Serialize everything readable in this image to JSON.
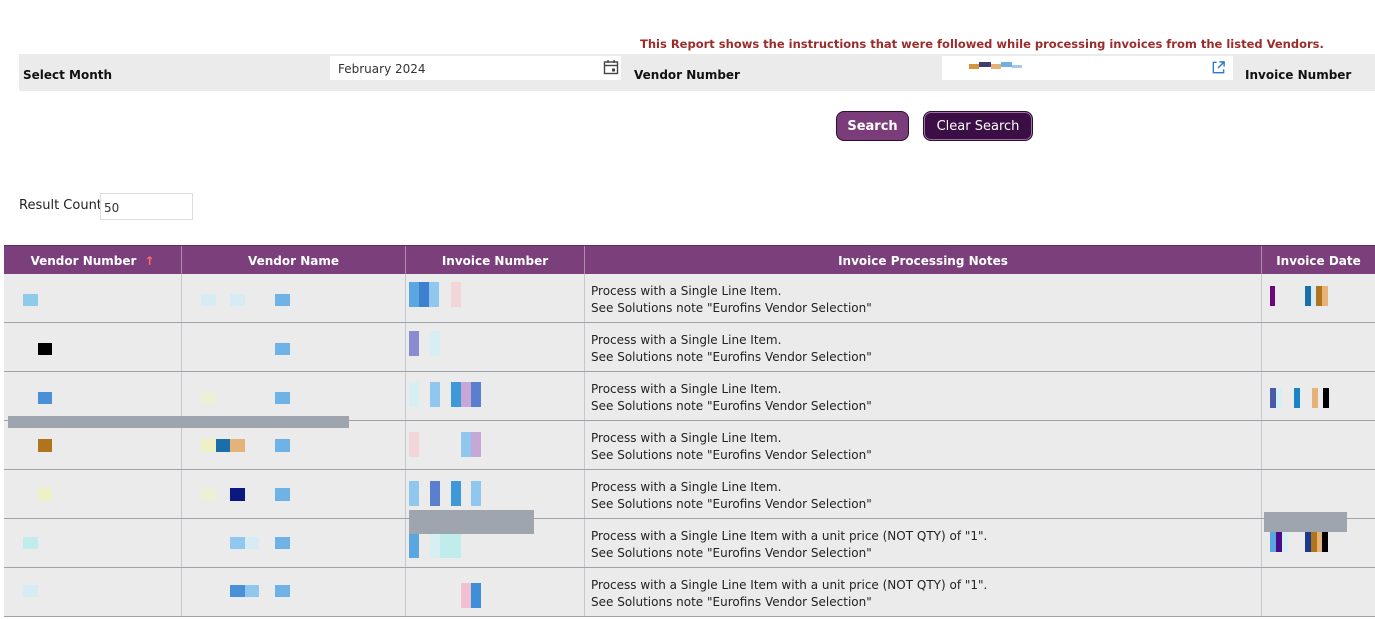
{
  "banner": "This Report shows the instructions that were followed while processing invoices from the listed Vendors.",
  "filters": {
    "month_label": "Select Month",
    "month_value": "February 2024",
    "vendor_label": "Vendor Number",
    "invoice_label": "Invoice Number"
  },
  "buttons": {
    "search": "Search",
    "clear": "Clear Search"
  },
  "result_count": {
    "label": "Result Count",
    "value": "50"
  },
  "columns": [
    "Vendor Number",
    "Vendor Name",
    "Invoice Number",
    "Invoice Processing Notes",
    "Invoice Date"
  ],
  "rows": [
    {
      "note1": "Process with a Single Line Item.",
      "note2": "See Solutions note \"Eurofins Vendor Selection\""
    },
    {
      "note1": "Process with a Single Line Item.",
      "note2": "See Solutions note \"Eurofins Vendor Selection\""
    },
    {
      "note1": "Process with a Single Line Item.",
      "note2": "See Solutions note \"Eurofins Vendor Selection\""
    },
    {
      "note1": "Process with a Single Line Item.",
      "note2": "See Solutions note \"Eurofins Vendor Selection\""
    },
    {
      "note1": "Process with a Single Line Item.",
      "note2": "See Solutions note \"Eurofins Vendor Selection\""
    },
    {
      "note1": "Process with a Single Line Item with a unit price (NOT QTY) of \"1\".",
      "note2": "See Solutions note \"Eurofins Vendor Selection\""
    },
    {
      "note1": "Process with a Single Line Item with a unit price (NOT QTY) of \"1\".",
      "note2": "See Solutions note \"Eurofins Vendor Selection\""
    }
  ],
  "colors": {
    "header_bg": "#7b3f7b",
    "banner_text": "#9b2c2c",
    "search_btn": "#7a3d7a",
    "clear_btn": "#3b0f45"
  },
  "icons": {
    "calendar": "calendar-icon",
    "external_link": "external-link-icon",
    "sort": "sort-ascending-icon"
  }
}
